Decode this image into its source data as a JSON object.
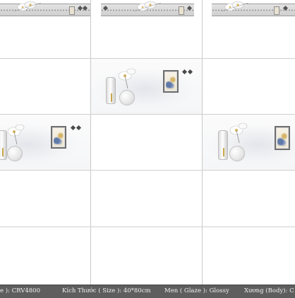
{
  "info_bar": {
    "code_label": "e ): CRV4800",
    "size_label": "Kích Thước ( Size ): 40*80cm",
    "glaze_label": "Men ( Glaze ): Glossy",
    "body_label": "Xương (Body): C"
  },
  "colors": {
    "grout": "#c9c9c9",
    "tile": "#ffffff",
    "info_bar_bg": "#5e5e5e",
    "info_bar_text": "#f2f2f2",
    "frame_border": "#6e6e6e",
    "vase_gold": "#c9a64a",
    "art_blue": "#5f79a8"
  },
  "icons": [
    "flower-spray-icon",
    "picture-frame-icon",
    "vase-icon",
    "diamond-ornament-icon"
  ]
}
